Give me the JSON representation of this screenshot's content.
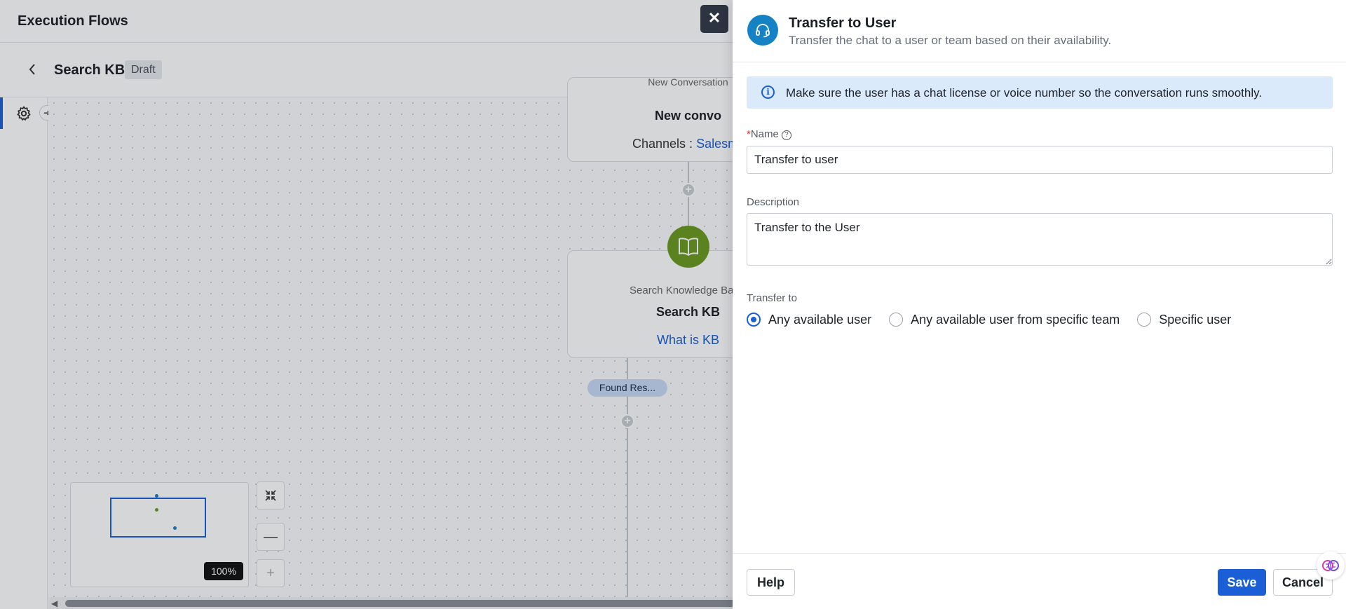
{
  "app": {
    "title": "Execution Flows"
  },
  "flow": {
    "name": "Search KB",
    "status": "Draft"
  },
  "canvas": {
    "node_conversation": {
      "cut_type": "New Conversation",
      "title": "New convo",
      "channels_label": "Channels :",
      "channels_value": "Salesma"
    },
    "node_kb": {
      "type": "Search Knowledge Ba",
      "title": "Search KB",
      "query": "What is KB"
    },
    "branch_label": "Found Res...",
    "zoom": "100%"
  },
  "drawer": {
    "title": "Transfer to User",
    "subtitle": "Transfer the chat to a user or team based on their availability.",
    "info": "Make sure the user has a chat license or voice number so the conversation runs smoothly.",
    "name_required": "*",
    "name_label": "Name",
    "name_value": "Transfer to user",
    "description_label": "Description",
    "description_value": "Transfer to the User",
    "transfer_label": "Transfer to",
    "transfer_options": [
      {
        "label": "Any available user",
        "checked": true
      },
      {
        "label": "Any available user from specific team",
        "checked": false
      },
      {
        "label": "Specific user",
        "checked": false
      }
    ],
    "help_button": "Help",
    "save_button": "Save",
    "cancel_button": "Cancel"
  },
  "icons": {
    "close": "close-icon",
    "back": "chevron-left-icon",
    "settings": "gear-icon",
    "expand": "arrow-right-icon",
    "kb": "book-icon",
    "drawer": "headset-icon",
    "info": "info-icon",
    "help": "question-icon",
    "fit": "fit-view-icon",
    "zoom_out": "minus-icon",
    "zoom_in": "plus-icon",
    "assistant": "brain-icon"
  },
  "colors": {
    "primary": "#1a5fd6",
    "kb_node": "#6a9a1f",
    "drawer_icon": "#1582c5",
    "info_bg": "#dbeafb"
  }
}
